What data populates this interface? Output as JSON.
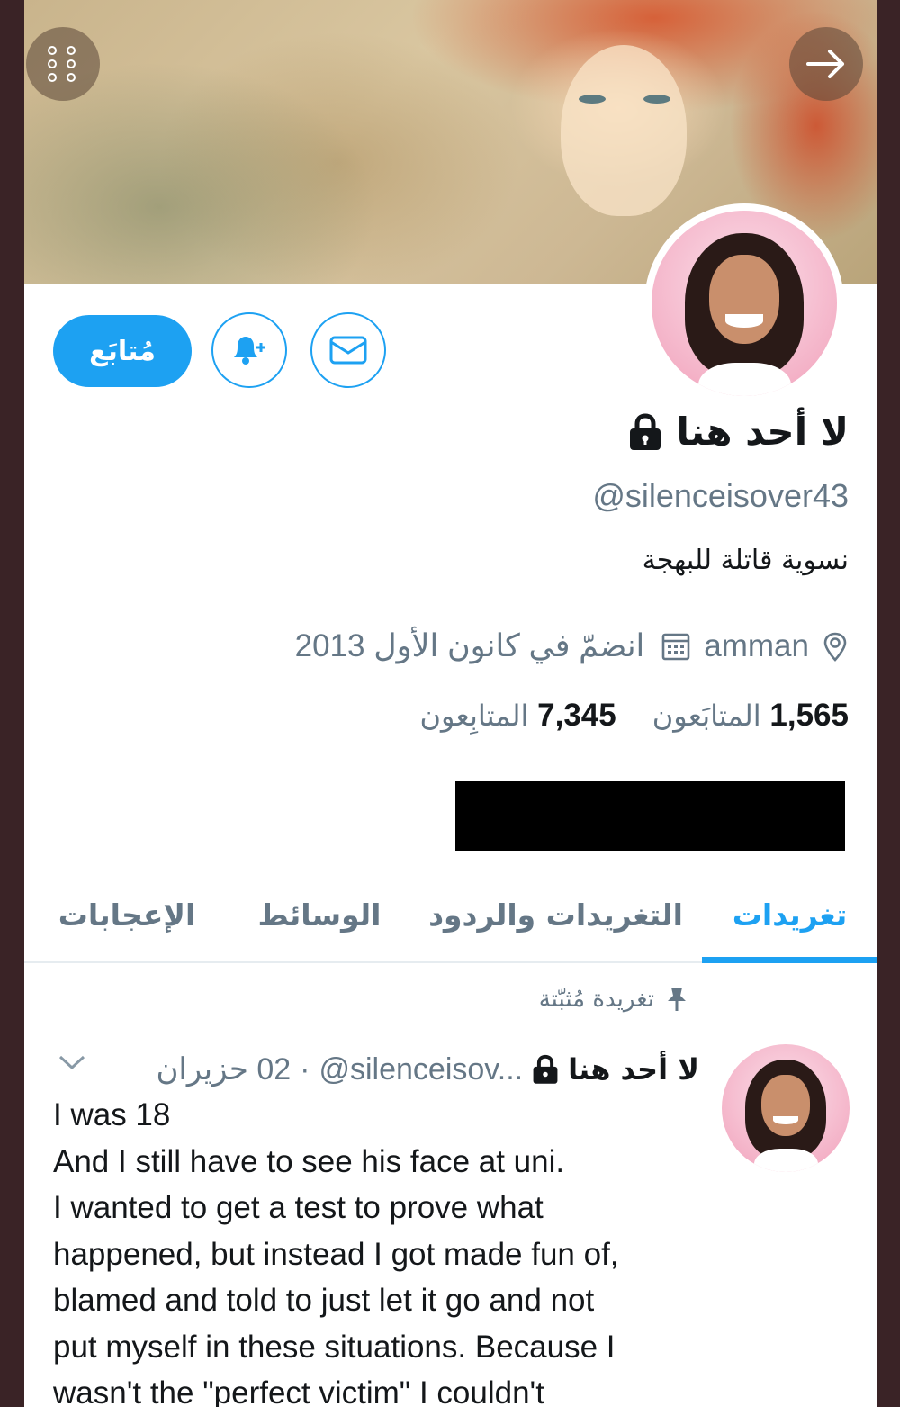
{
  "profile": {
    "display_name": "لا أحد هنا",
    "handle": "@silenceisover43",
    "bio": "نسوية قاتلة للبهجة",
    "location": "amman",
    "joined": "انضمّ في كانون الأول 2013",
    "following_count": "1,565",
    "following_label": "المتابَعون",
    "followers_count": "7,345",
    "followers_label": "المتابِعون"
  },
  "actions": {
    "follow_label": "مُتابَع"
  },
  "tabs": [
    {
      "label": "تغريدات",
      "active": true
    },
    {
      "label": "التغريدات والردود",
      "active": false
    },
    {
      "label": "الوسائط",
      "active": false
    },
    {
      "label": "الإعجابات",
      "active": false
    }
  ],
  "tweet": {
    "pinned_label": "تغريدة مُثبّتة",
    "author_name": "لا أحد هنا",
    "author_handle": "@silenceisov...",
    "date": "02 حزيران",
    "separator": "·",
    "lines": [
      "I was 18",
      "And I still have to see his face at uni.",
      "I wanted to get a test to prove what",
      "happened, but instead I got made fun of,",
      "blamed and told to just let it go and not",
      "put myself in these situations. Because I",
      "wasn't the \"perfect victim\" I couldn't"
    ]
  },
  "colors": {
    "accent": "#1da1f2",
    "text": "#14171a",
    "muted": "#657786",
    "redaction": "#000000"
  },
  "icons": [
    "more-icon",
    "forward-arrow-icon",
    "bell-plus-icon",
    "envelope-icon",
    "lock-icon",
    "location-pin-icon",
    "calendar-icon",
    "pin-icon",
    "chevron-down-icon"
  ]
}
